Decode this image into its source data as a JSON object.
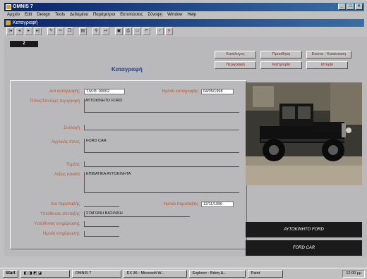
{
  "app": {
    "title": "OMNIS 7"
  },
  "menu": [
    "Αρχείο",
    "Edit",
    "Design",
    "Tools",
    "Δεδομένα",
    "Παράμετροι",
    "Εκτυπώσεις",
    "Σύνοψη",
    "Window",
    "Help"
  ],
  "window": {
    "title": "Καταγραφή"
  },
  "toolbar": {
    "icons": [
      "first-record-icon",
      "previous-record-icon",
      "next-record-icon",
      "last-record-icon",
      "edit-icon",
      "cut-icon",
      "copy-icon",
      "find-icon",
      "binoculars-icon",
      "goto-icon",
      "save-icon",
      "print-icon",
      "delete-icon",
      "undo-icon",
      "cancel-icon"
    ]
  },
  "record": {
    "number": "2"
  },
  "form": {
    "title": "Καταγραφή",
    "buttons": {
      "list": "Κατάλογος",
      "add": "Προσθήκη",
      "image_insert": "Εικόνα - Κατάσταση",
      "description": "Περιγραφή",
      "category": "Κατηγορία",
      "history": "Ιστορία"
    },
    "fields": {
      "catalog_number": {
        "label": "Α/α καταγραφής",
        "value": "Τ.Μ.Θ. 00002"
      },
      "catalog_date": {
        "label": "Ημ/νία καταγραφής",
        "value": "04/05/1998"
      },
      "title_description": {
        "label": "Τίτλος/Σύντομη περιγραφή",
        "value": "ΑΥΤΟΚΙΝΗΤΟ FORD"
      },
      "collection": {
        "label": "Συλλογή",
        "value": ""
      },
      "english_title": {
        "label": "Αγγλικός τίτλος",
        "value": "FORD CAR"
      },
      "section": {
        "label": "Τομέας",
        "value": ""
      },
      "keywords": {
        "label": "Λέξεις κλειδιά",
        "value": "ΕΠΙΒΑΤΙΚΑ ΑΥΤΟΚΙΝΗΤΑ"
      },
      "receipt_number": {
        "label": "Α/α παραλαβής",
        "value": ""
      },
      "receipt_date": {
        "label": "Ημ/νία παραλαβής",
        "value": "12/11/1996"
      },
      "owner_responsible": {
        "label": "Υπεύθυνος σύνταξης",
        "value": "ΣΤΑΓΩΝΗ ΒΑΣΙΛΙΚΗ"
      },
      "update_responsible": {
        "label": "Υπεύθυνος ενημέρωσης",
        "value": ""
      },
      "update_date": {
        "label": "Ημ/νία ενημέρωσης",
        "value": ""
      }
    }
  },
  "image_panel": {
    "caption_greek": "ΑΥΤΟΚΙΝΗΤΟ FORD",
    "caption_english": "FORD CAR"
  },
  "taskbar": {
    "start": "Start",
    "tasks": [
      "OMNIS 7",
      "EX 36 - Microsoft W...",
      "Explorer - Βάση Δ...",
      "Paint"
    ],
    "clock": "12:00 μμ"
  }
}
